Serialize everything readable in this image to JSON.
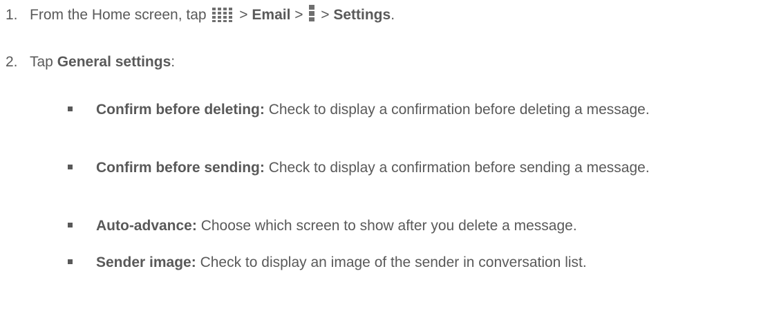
{
  "steps": [
    {
      "number": "1.",
      "prefix": "From the Home screen, tap",
      "sep1": ">",
      "email": "Email",
      "sep2": ">",
      "sep3": ">",
      "settings": "Settings",
      "end": ".",
      "icons": [
        "apps-grid-icon",
        "menu-icon"
      ]
    },
    {
      "number": "2.",
      "prefix": "Tap",
      "bold": "General settings",
      "suffix": ":"
    }
  ],
  "bullets": [
    {
      "term": "Confirm before deleting:",
      "desc": "Check to display a confirmation before deleting a message."
    },
    {
      "term": "Confirm before sending:",
      "desc": "Check to display a confirmation before sending a message."
    },
    {
      "term": "Auto-advance:",
      "desc": "Choose which screen to show after you delete a message."
    },
    {
      "term": "Sender image:",
      "desc": "Check to display an image of the sender in conversation list."
    }
  ],
  "colors": {
    "text": "#595959",
    "background": "#ffffff"
  }
}
